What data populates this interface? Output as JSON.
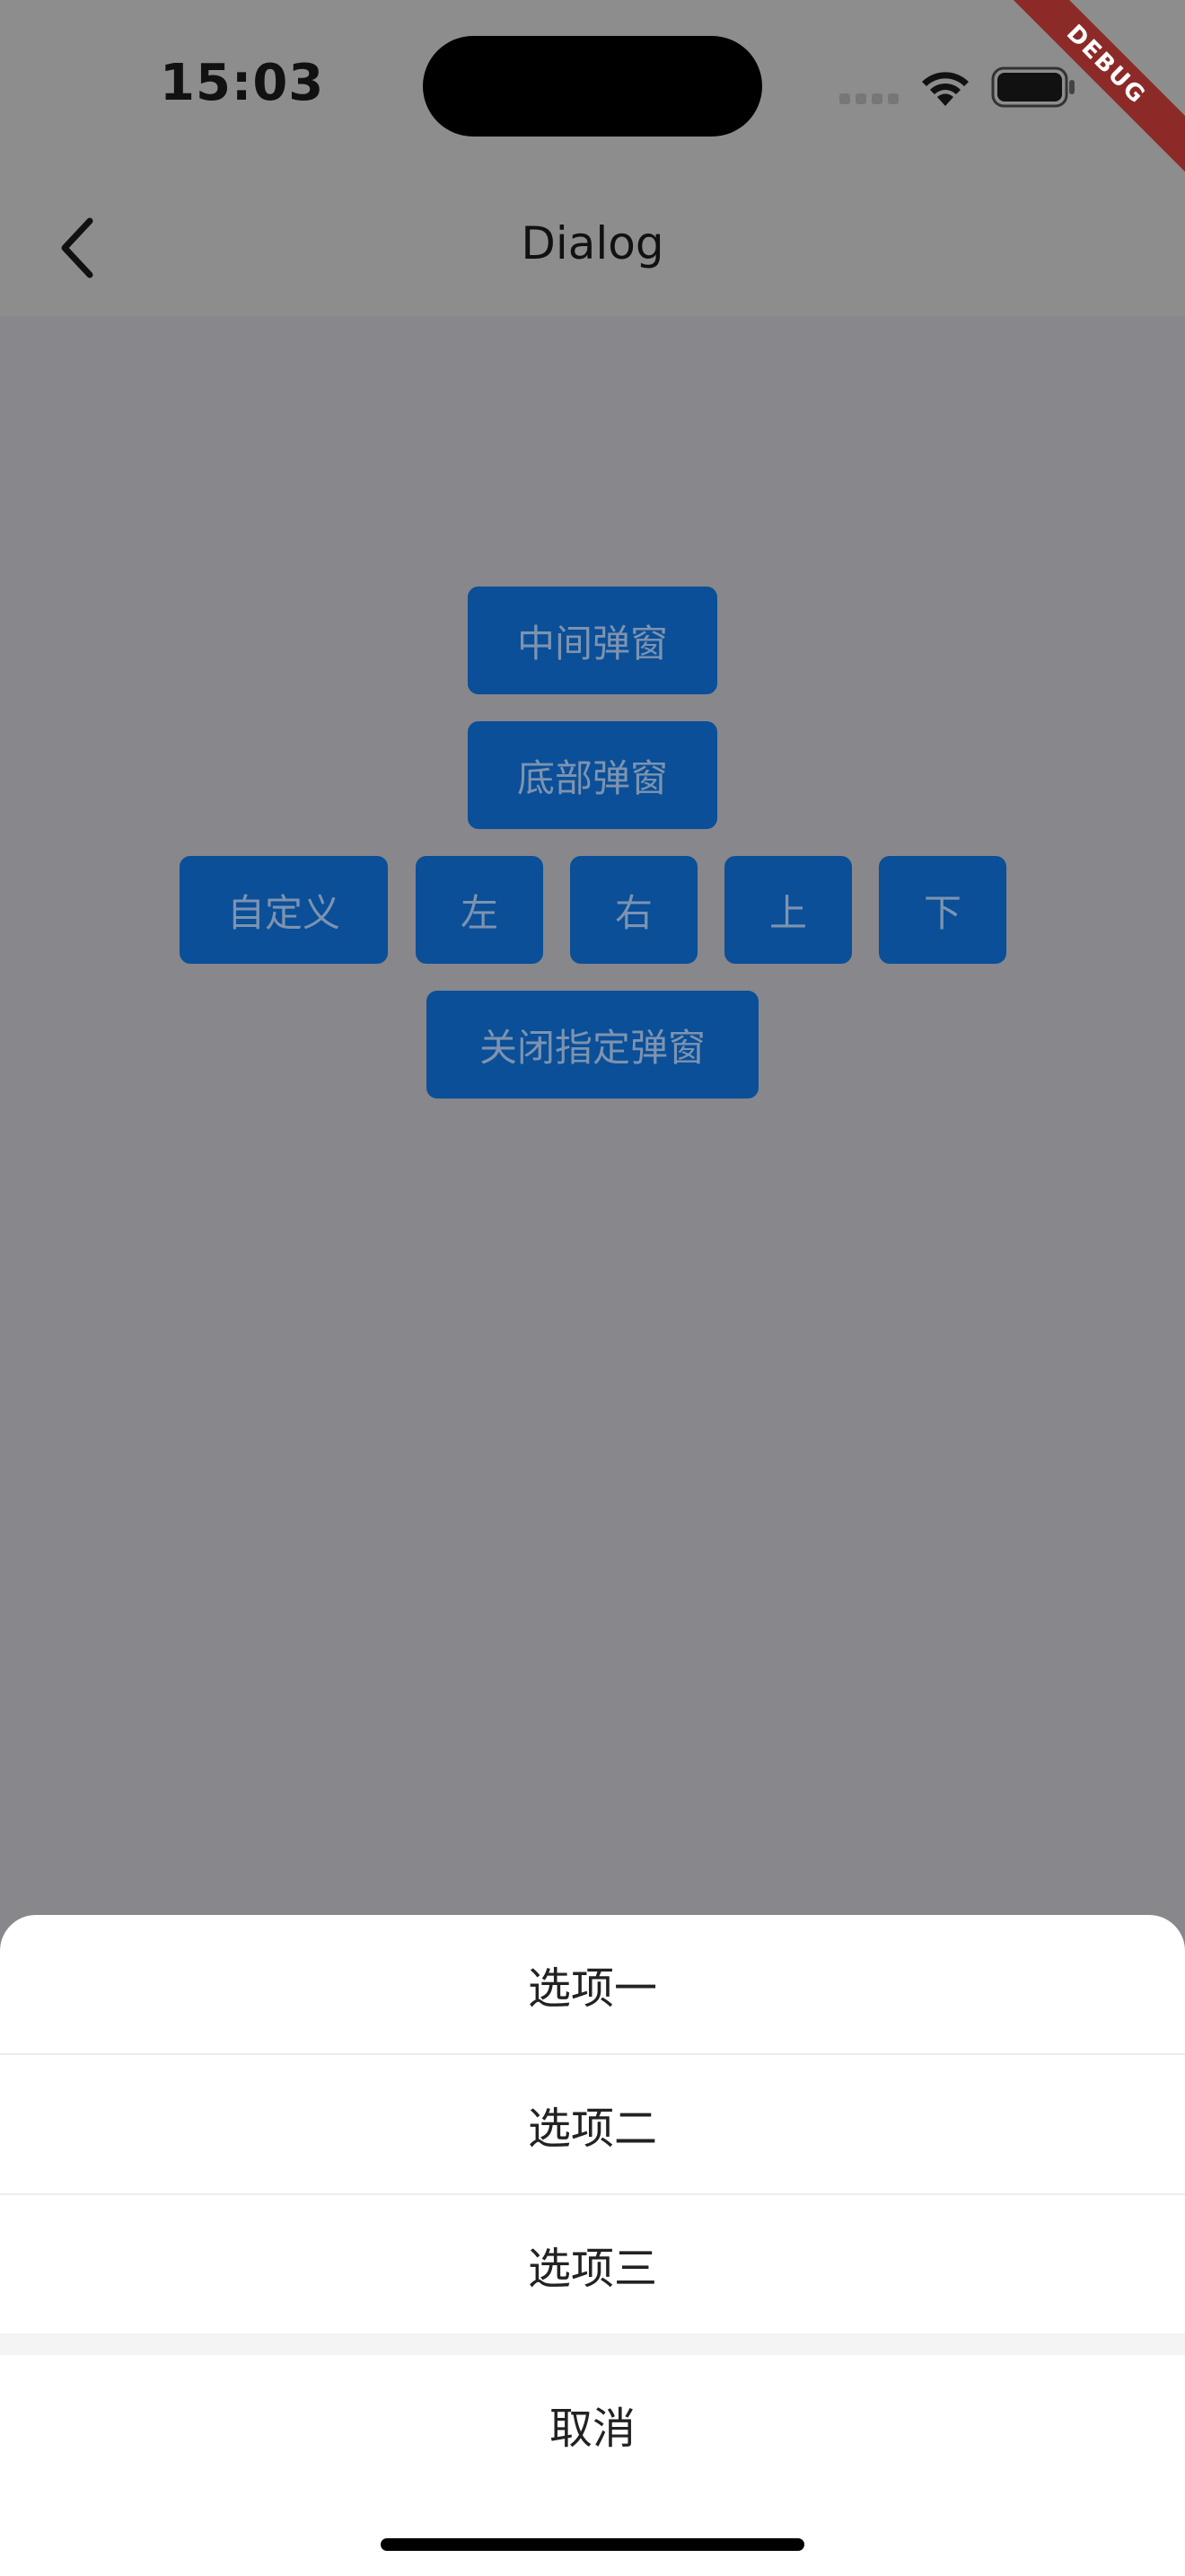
{
  "status_bar": {
    "time": "15:03"
  },
  "debug_banner": "DEBUG",
  "nav": {
    "title": "Dialog",
    "back_icon": "chevron-left-icon"
  },
  "buttons": {
    "center_dialog": "中间弹窗",
    "bottom_dialog": "底部弹窗",
    "custom": "自定义",
    "left": "左",
    "right": "右",
    "top": "上",
    "bottom": "下",
    "close_specific": "关闭指定弹窗"
  },
  "sheet": {
    "options": [
      "选项一",
      "选项二",
      "选项三"
    ],
    "cancel": "取消"
  },
  "colors": {
    "button_bg": "#0a4f97",
    "overlay": "#87878c",
    "sheet_bg": "#ffffff"
  }
}
